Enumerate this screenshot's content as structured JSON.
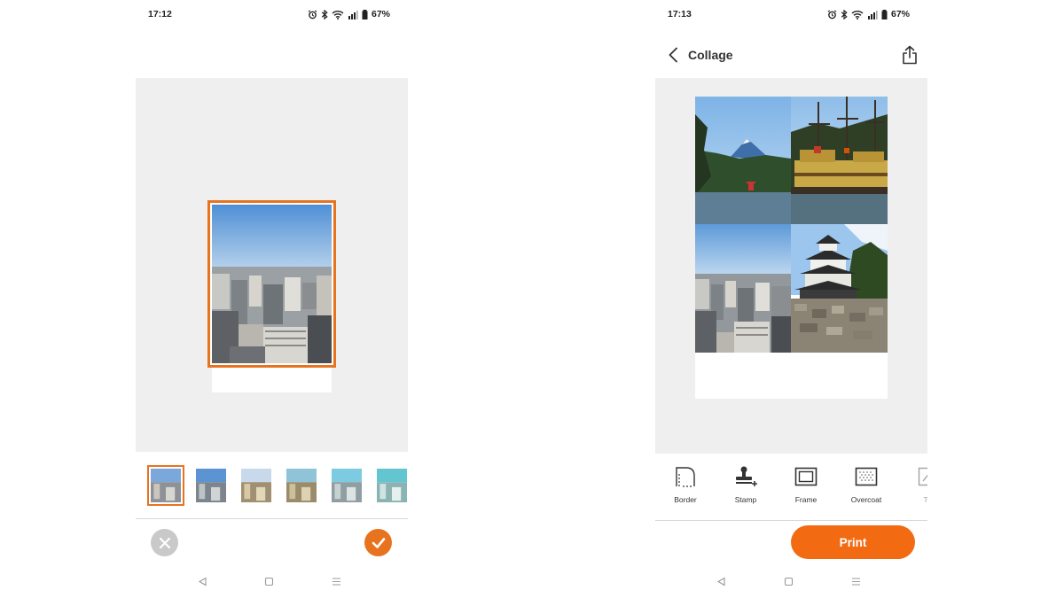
{
  "left_screen": {
    "status_bar": {
      "time": "17:12",
      "battery": "67%"
    },
    "filters": [
      {
        "name": "original",
        "selected": true
      },
      {
        "name": "filter-1",
        "selected": false
      },
      {
        "name": "filter-2",
        "selected": false
      },
      {
        "name": "filter-3",
        "selected": false
      },
      {
        "name": "filter-4",
        "selected": false
      },
      {
        "name": "filter-5",
        "selected": false
      }
    ],
    "cancel_icon": "close-icon",
    "confirm_icon": "check-icon"
  },
  "right_screen": {
    "status_bar": {
      "time": "17:13",
      "battery": "67%"
    },
    "header": {
      "title": "Collage",
      "back_icon": "chevron-left-icon",
      "share_icon": "share-icon"
    },
    "tools": [
      {
        "label": "Border",
        "icon": "border-icon"
      },
      {
        "label": "Stamp",
        "icon": "stamp-icon"
      },
      {
        "label": "Frame",
        "icon": "frame-icon"
      },
      {
        "label": "Overcoat",
        "icon": "overcoat-icon"
      },
      {
        "label": "Te",
        "icon": "text-icon"
      }
    ],
    "print_label": "Print"
  },
  "nav_icons": [
    "back-triangle-icon",
    "home-square-icon",
    "recents-menu-icon"
  ],
  "colors": {
    "accent": "#e8731f",
    "print_button": "#f26b13",
    "canvas_bg": "#efefef",
    "cancel_gray": "#c9c9c9"
  }
}
